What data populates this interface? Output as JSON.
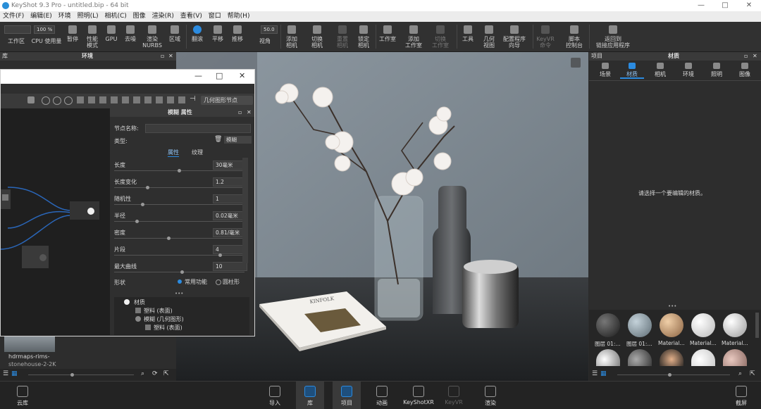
{
  "window": {
    "title": "KeyShot 9.3 Pro - untitled.bip - 64 bit",
    "controls": [
      "—",
      "□",
      "✕"
    ]
  },
  "menu": [
    "文件(F)",
    "编辑(E)",
    "环境",
    "照明(L)",
    "相机(C)",
    "图像",
    "渲染(R)",
    "查看(V)",
    "窗口",
    "帮助(H)"
  ],
  "toolbar": {
    "cpu_value": "100 %",
    "fov_value": "50.0",
    "items": [
      {
        "label": "工作区"
      },
      {
        "label": "CPU 使用量"
      },
      {
        "label": "暂停"
      },
      {
        "label": "性能\n模式"
      },
      {
        "label": "GPU"
      },
      {
        "label": "去噪"
      },
      {
        "label": "渲染\nNURBS"
      },
      {
        "label": "区域"
      },
      {
        "label": "翻滚"
      },
      {
        "label": "平移"
      },
      {
        "label": "推移"
      },
      {
        "label": "视角"
      },
      {
        "label": "添加\n相机"
      },
      {
        "label": "切换\n相机"
      },
      {
        "label": "重置\n相机"
      },
      {
        "label": "锁定\n相机"
      },
      {
        "label": "工作室"
      },
      {
        "label": "添加\n工作室"
      },
      {
        "label": "切换\n工作室"
      },
      {
        "label": "工具"
      },
      {
        "label": "几何\n视图"
      },
      {
        "label": "配置程序\n向导"
      },
      {
        "label": "KeyVR\n命令"
      },
      {
        "label": "脚本\n控制台"
      },
      {
        "label": "返回到\n链接应用程序"
      }
    ]
  },
  "left_panel": {
    "title_lib": "库",
    "title_env": "环境",
    "thumb_label": "hdrmaps-rims-",
    "thumb_label2": "stonehouse-2-2K"
  },
  "editor": {
    "props_title": "模糊 属性",
    "node_btn": "几何图形节点",
    "node_name_label": "节点名称:",
    "type_label": "类型:",
    "type_value": "模糊",
    "tabs": [
      "属性",
      "纹理"
    ],
    "params": [
      {
        "label": "长度",
        "value": "30毫米"
      },
      {
        "label": "长度变化",
        "value": "1.2"
      },
      {
        "label": "随机性",
        "value": "1"
      },
      {
        "label": "半径",
        "value": "0.02毫米"
      },
      {
        "label": "密度",
        "value": "0.81/毫米"
      },
      {
        "label": "片段",
        "value": "4"
      },
      {
        "label": "最大曲线",
        "value": "10"
      }
    ],
    "shape_label": "形状",
    "shape_options": [
      "常用功能",
      "圆柱形"
    ],
    "tree": [
      {
        "label": "材质"
      },
      {
        "label": "塑料 (表面)"
      },
      {
        "label": "模糊 (几何图形)"
      },
      {
        "label": "塑料 (表面)"
      }
    ]
  },
  "viewport": {
    "book_text": "KINFOLK"
  },
  "right_panel": {
    "title_proj": "项目",
    "title_mat": "材质",
    "tabs": [
      "场景",
      "材质",
      "相机",
      "环境",
      "照明",
      "图像"
    ],
    "hint": "请选择一个要编辑的材质。",
    "materials": [
      {
        "label": "图层 01:...",
        "color": "#3a3a3a"
      },
      {
        "label": "图层 01:...",
        "color": "#8b9aa4"
      },
      {
        "label": "Material...",
        "color": "#c9a07a"
      },
      {
        "label": "Material...",
        "color": "#f2f2f2"
      },
      {
        "label": "Material...",
        "color": "#e8e8e8"
      }
    ]
  },
  "bottombar": {
    "items": [
      "云库",
      "导入",
      "库",
      "项目",
      "动画",
      "KeyShotXR",
      "KeyVR",
      "渲染",
      "截屏"
    ]
  }
}
